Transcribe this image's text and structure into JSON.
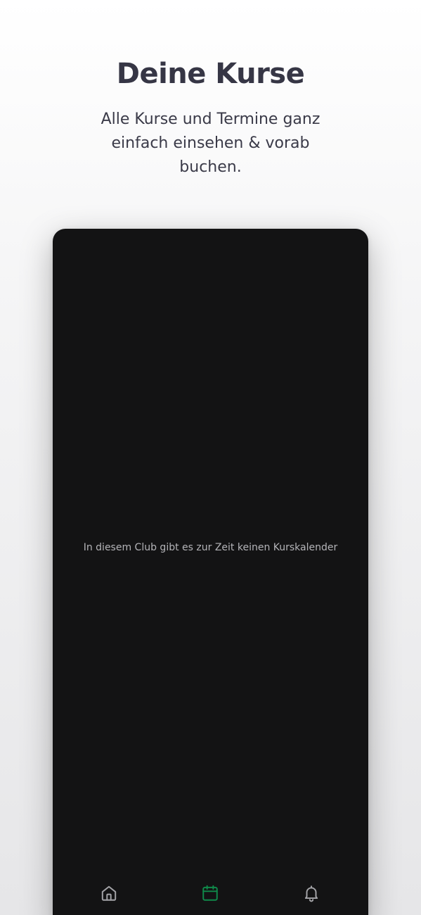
{
  "promo": {
    "title": "Deine Kurse",
    "subtitle": "Alle Kurse und Termine ganz einfach einsehen & vorab buchen."
  },
  "app": {
    "empty_message": "In diesem Club gibt es zur Zeit keinen Kurskalender",
    "tabbar": {
      "active_tab": "calendar",
      "tabs": [
        {
          "id": "home",
          "icon": "home-icon"
        },
        {
          "id": "calendar",
          "icon": "calendar-icon"
        },
        {
          "id": "notifications",
          "icon": "bell-icon"
        }
      ]
    }
  },
  "colors": {
    "accent": "#0f8a4a",
    "inactive_icon": "#a4a4a8",
    "screen_background": "#131314",
    "headline": "#363645"
  }
}
